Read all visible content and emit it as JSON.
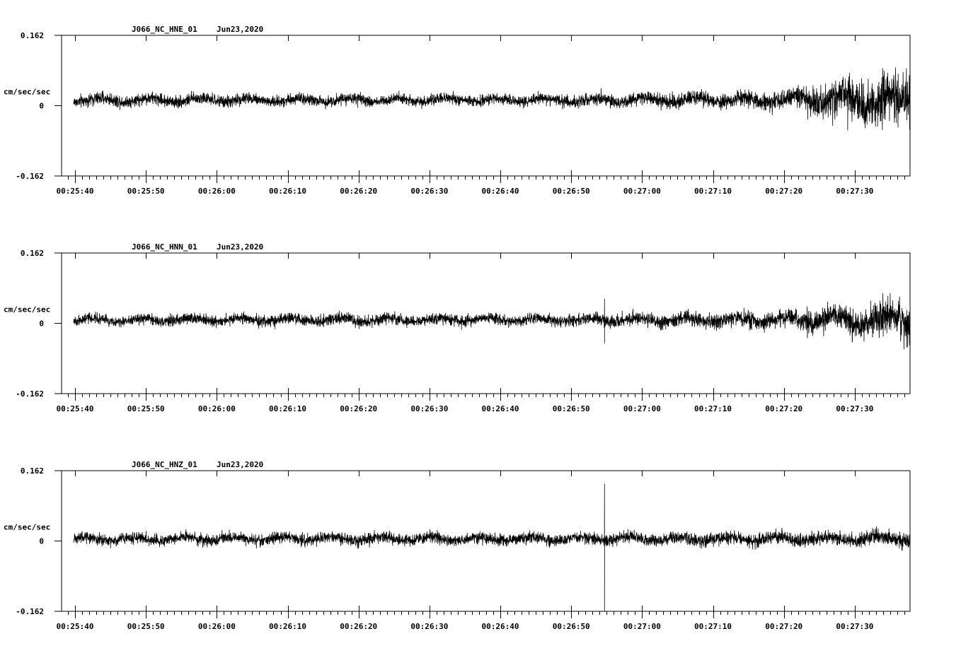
{
  "chart_data": [
    {
      "type": "line",
      "station_label": "J066_NC_HNE_01",
      "date_label": "Jun23,2020",
      "ylabel": "cm/sec/sec",
      "y_top_label": "0.162",
      "y_mid_label": "0",
      "y_bottom_label": "-0.162",
      "ylim": [
        -0.162,
        0.162
      ],
      "xlim": [
        "00:25:38.1",
        "00:27:37.8"
      ],
      "x_tick_labels": [
        "00:25:40",
        "00:25:50",
        "00:26:00",
        "00:26:10",
        "00:26:20",
        "00:26:30",
        "00:26:40",
        "00:26:50",
        "00:27:00",
        "00:27:10",
        "00:27:20",
        "00:27:30"
      ],
      "x_seconds_after_minute_25": [
        40,
        50,
        60,
        70,
        80,
        90,
        100,
        110,
        120,
        130,
        140,
        150
      ],
      "trace_start": "00:25:39.8",
      "trace_end": "00:27:37.8",
      "approx_offset": 0.013,
      "approx_amplitude_envelope": [
        {
          "t": "00:25:40",
          "amp": 0.013
        },
        {
          "t": "00:26:40",
          "amp": 0.011
        },
        {
          "t": "00:27:20",
          "amp": 0.018
        },
        {
          "t": "00:27:30",
          "amp": 0.045
        },
        {
          "t": "00:27:37",
          "amp": 0.05
        }
      ],
      "peaks": [
        {
          "t": "00:27:29.0",
          "value": -0.057
        },
        {
          "t": "00:27:34.0",
          "value": 0.058
        }
      ]
    },
    {
      "type": "line",
      "station_label": "J066_NC_HNN_01",
      "date_label": "Jun23,2020",
      "ylabel": "cm/sec/sec",
      "y_top_label": "0.162",
      "y_mid_label": "0",
      "y_bottom_label": "-0.162",
      "ylim": [
        -0.162,
        0.162
      ],
      "xlim": [
        "00:25:38.1",
        "00:27:37.8"
      ],
      "x_tick_labels": [
        "00:25:40",
        "00:25:50",
        "00:26:00",
        "00:26:10",
        "00:26:20",
        "00:26:30",
        "00:26:40",
        "00:26:50",
        "00:27:00",
        "00:27:10",
        "00:27:20",
        "00:27:30"
      ],
      "trace_start": "00:25:39.8",
      "trace_end": "00:27:37.8",
      "approx_offset": 0.008,
      "approx_amplitude_envelope": [
        {
          "t": "00:25:40",
          "amp": 0.011
        },
        {
          "t": "00:26:50",
          "amp": 0.012
        },
        {
          "t": "00:27:20",
          "amp": 0.018
        },
        {
          "t": "00:27:37",
          "amp": 0.04
        }
      ],
      "peaks": [
        {
          "t": "00:26:54.7",
          "value": 0.057
        },
        {
          "t": "00:26:54.7",
          "value": -0.046
        }
      ]
    },
    {
      "type": "line",
      "station_label": "J066_NC_HNZ_01",
      "date_label": "Jun23,2020",
      "ylabel": "cm/sec/sec",
      "y_top_label": "0.162",
      "y_mid_label": "0",
      "y_bottom_label": "-0.162",
      "ylim": [
        -0.162,
        0.162
      ],
      "xlim": [
        "00:25:38.1",
        "00:27:37.8"
      ],
      "x_tick_labels": [
        "00:25:40",
        "00:25:50",
        "00:26:00",
        "00:26:10",
        "00:26:20",
        "00:26:30",
        "00:26:40",
        "00:26:50",
        "00:27:00",
        "00:27:10",
        "00:27:20",
        "00:27:30"
      ],
      "trace_start": "00:25:39.8",
      "trace_end": "00:27:37.8",
      "approx_offset": 0.005,
      "approx_amplitude_envelope": [
        {
          "t": "00:25:40",
          "amp": 0.012
        },
        {
          "t": "00:26:50",
          "amp": 0.012
        },
        {
          "t": "00:27:37",
          "amp": 0.016
        }
      ],
      "peaks": [
        {
          "t": "00:26:54.7",
          "value": 0.132
        },
        {
          "t": "00:26:54.7",
          "value": -0.162
        }
      ]
    }
  ]
}
